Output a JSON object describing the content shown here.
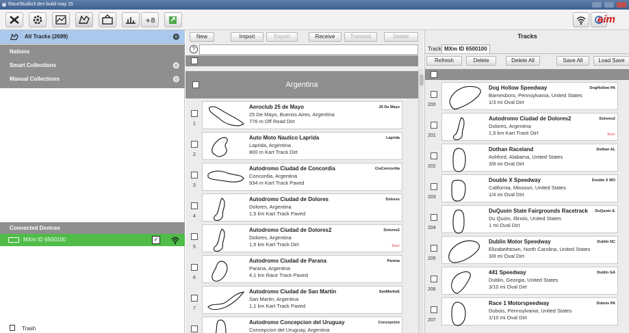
{
  "window": {
    "title": "RaceStudio3 dev build may 15"
  },
  "toolbar": {
    "tools": [
      {
        "name": "settings-tools-icon"
      },
      {
        "name": "configuration-icon"
      },
      {
        "name": "data-download-icon"
      },
      {
        "name": "tracks-icon"
      },
      {
        "name": "dashboard-icon"
      },
      {
        "name": "calibration-icon"
      },
      {
        "name": "channels-icon"
      },
      {
        "name": "transmit-icon"
      }
    ],
    "right_icons": [
      "wifi-icon",
      "device-status-icon"
    ],
    "brand": "aim"
  },
  "left": {
    "all_tracks": "All Tracks (2699)",
    "categories": [
      "Nations",
      "Smart Collections",
      "Manual Collections"
    ],
    "connected_header": "Connected Devices",
    "device_name": "MXm ID 6500100",
    "trash": "Trash"
  },
  "middle": {
    "actions": [
      "New",
      "Import",
      "Export",
      "Receive",
      "Transmit",
      "Delete"
    ],
    "disabled_actions": [
      "Export",
      "Transmit",
      "Delete"
    ],
    "search_value": "",
    "nation": "Argentina",
    "tracks": [
      {
        "num": "1",
        "name": "Aeroclub 25 de Mayo",
        "location": "25 De Mayo, Buenos Aires, Argentina",
        "length": "776 m Off Road Dirt",
        "short": "25 De Mayo",
        "badge": ""
      },
      {
        "num": "2",
        "name": "Auto Moto Nautico Laprida",
        "location": "Laprida, Argentina",
        "length": "800 m Kart Track Dirt",
        "short": "Laprida",
        "badge": ""
      },
      {
        "num": "3",
        "name": "Autodromo Ciudad de Concordia",
        "location": "Concordia, Argentina",
        "length": "934 m Kart Track Paved",
        "short": "CiuConcordia",
        "badge": ""
      },
      {
        "num": "4",
        "name": "Autodromo Ciudad de Dolores",
        "location": "Dolores, Argentina",
        "length": "1,5 km Kart Track Paved",
        "short": "Dolores",
        "badge": ""
      },
      {
        "num": "5",
        "name": "Autodromo Ciudad de Dolores2",
        "location": "Dolores, Argentina",
        "length": "1,5 km Kart Track Dirt",
        "short": "Dolores2",
        "badge": "Beer"
      },
      {
        "num": "6",
        "name": "Autodromo Ciudad de Parana",
        "location": "Parana, Argentina",
        "length": "4,1 km Race Track Paved",
        "short": "Parana",
        "badge": ""
      },
      {
        "num": "7",
        "name": "Autodromo Ciudad de San Martin",
        "location": "San Martin, Argentina",
        "length": "1,1 km Kart Track Paved",
        "short": "SanMartinE",
        "badge": ""
      },
      {
        "num": "8",
        "name": "Autodromo Concepcion del Uruguay",
        "location": "Concepcion del Uruguay, Argentina",
        "length": "",
        "short": "Concepcion",
        "badge": ""
      }
    ]
  },
  "right": {
    "title": "Tracks",
    "track_label": "Track",
    "device_tab": "MXm ID 6500100",
    "actions": [
      "Refresh",
      "Delete",
      "Delete All",
      "Save All",
      "Load Save"
    ],
    "tracks": [
      {
        "num": "200",
        "name": "Dog Hollow Speedway",
        "location": "Barnesboro, Pennsylvania, United States",
        "length": "1/3 mi Oval Dirt",
        "short": "DogHollow PA",
        "badge": ""
      },
      {
        "num": "201",
        "name": "Autodromo Ciudad de Dolores2",
        "location": "Dolores, Argentina",
        "length": "1,5 km Kart Track Dirt",
        "short": "Dolores2",
        "badge": "Beer"
      },
      {
        "num": "202",
        "name": "Dothan Raceland",
        "location": "Ashford, Alabama, United States",
        "length": "3/8 mi Oval Dirt",
        "short": "Dothan AL",
        "badge": ""
      },
      {
        "num": "203",
        "name": "Double X Speedway",
        "location": "California, Missouri, United States",
        "length": "1/4 mi Oval Dirt",
        "short": "Double X MO",
        "badge": ""
      },
      {
        "num": "204",
        "name": "DuQuoin State Fairgrounds Racetrack",
        "location": "Du Quoin, Illinois, United States",
        "length": "1 mi Oval Dirt",
        "short": "DuQuoin IL",
        "badge": ""
      },
      {
        "num": "205",
        "name": "Dublin Motor Speedway",
        "location": "Elizabethtown, North Carolina, United States",
        "length": "3/8 mi Oval Dirt",
        "short": "Dublin NC",
        "badge": ""
      },
      {
        "num": "206",
        "name": "441 Speedway",
        "location": "Dublin, Georgia, United States",
        "length": "3/10 mi Oval Dirt",
        "short": "Dublin GA",
        "badge": ""
      },
      {
        "num": "207",
        "name": "Race 1 Motorspeedway",
        "location": "Dubois, Pennsylvania, United States",
        "length": "1/10 mi Oval Dirt",
        "short": "Dubois PA",
        "badge": ""
      }
    ]
  },
  "colors": {
    "all_tracks_bg": "#a9c8ec",
    "section_gray": "#8f8f8f",
    "device_green": "#4fbd47",
    "brand_red": "#d01818"
  }
}
